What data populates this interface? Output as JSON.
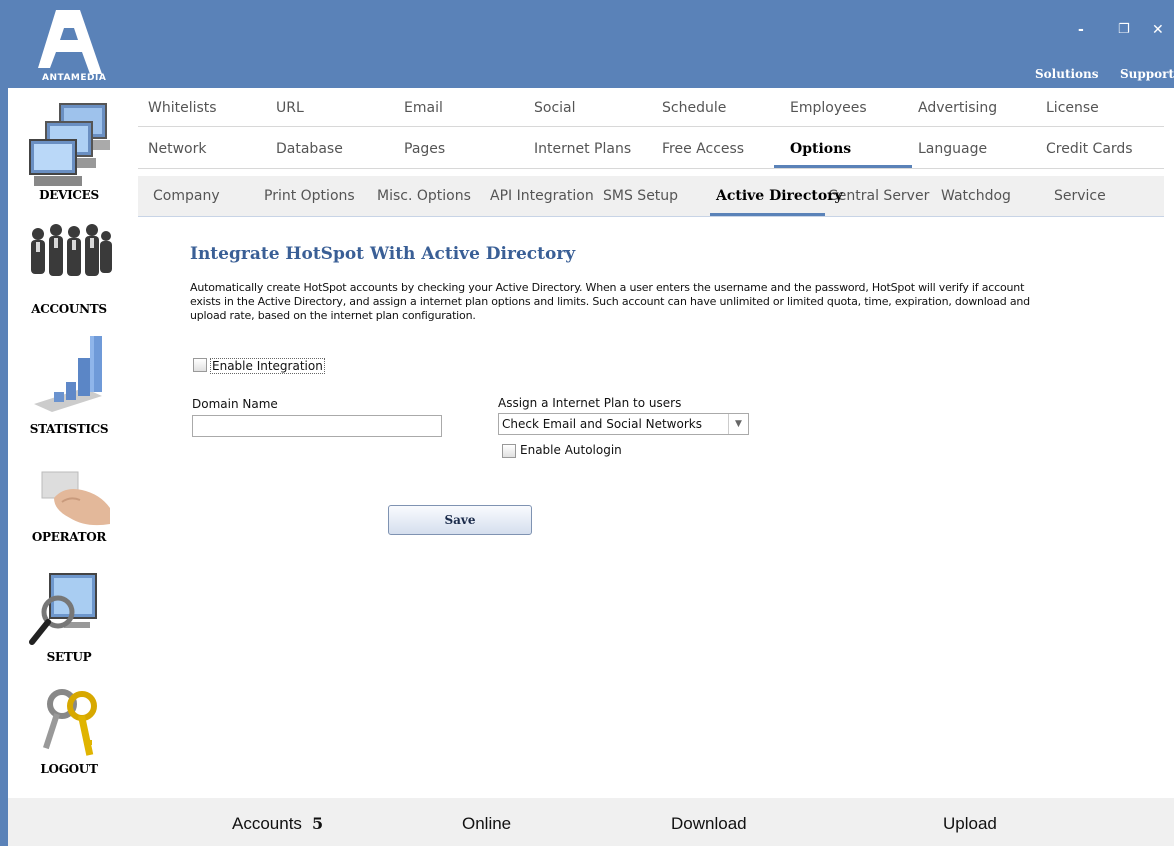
{
  "app": {
    "logo_text": "ANTAMEDIA",
    "top_links": [
      "Solutions",
      "Support"
    ],
    "window_controls": {
      "minimize": "-",
      "restore": "❐",
      "close": "✕"
    }
  },
  "sidebar": {
    "items": [
      {
        "label": "DEVICES",
        "icon": "computers-icon"
      },
      {
        "label": "ACCOUNTS",
        "icon": "people-icon"
      },
      {
        "label": "STATISTICS",
        "icon": "bar-chart-icon"
      },
      {
        "label": "OPERATOR",
        "icon": "hand-card-icon"
      },
      {
        "label": "SETUP",
        "icon": "monitor-magnifier-icon"
      },
      {
        "label": "LOGOUT",
        "icon": "keys-icon"
      }
    ]
  },
  "tabs": {
    "row1": [
      "Whitelists",
      "URL",
      "Email",
      "Social",
      "Schedule",
      "Employees",
      "Advertising",
      "License"
    ],
    "row2": [
      "Network",
      "Database",
      "Pages",
      "Internet Plans",
      "Free Access",
      "Options",
      "Language",
      "Credit Cards"
    ],
    "row2_active": "Options"
  },
  "subtabs": {
    "items": [
      "Company",
      "Print Options",
      "Misc. Options",
      "API Integration",
      "SMS Setup",
      "Active Directory",
      "Central Server",
      "Watchdog",
      "Service"
    ],
    "active": "Active Directory"
  },
  "main": {
    "title": "Integrate HotSpot With Active Directory",
    "description": "Automatically create HotSpot accounts by checking your Active Directory. When a user enters the username and the password, HotSpot will verify if account exists in the Active Directory, and assign a internet plan options and limits. Such account can have unlimited or limited quota, time, expiration, download and upload rate, based on the internet plan configuration.",
    "enable_integration_label": "Enable Integration",
    "enable_integration_checked": false,
    "domain_name_label": "Domain Name",
    "domain_name_value": "",
    "plan_label": "Assign a Internet Plan to users",
    "plan_selected": "Check Email and Social Networks",
    "enable_autologin_label": "Enable Autologin",
    "enable_autologin_checked": false,
    "save_label": "Save"
  },
  "status": {
    "accounts_label": "Accounts",
    "accounts_count": "5",
    "online_label": "Online",
    "download_label": "Download",
    "upload_label": "Upload"
  },
  "colors": {
    "accent": "#5a82b8",
    "heading": "#3a5f96"
  }
}
